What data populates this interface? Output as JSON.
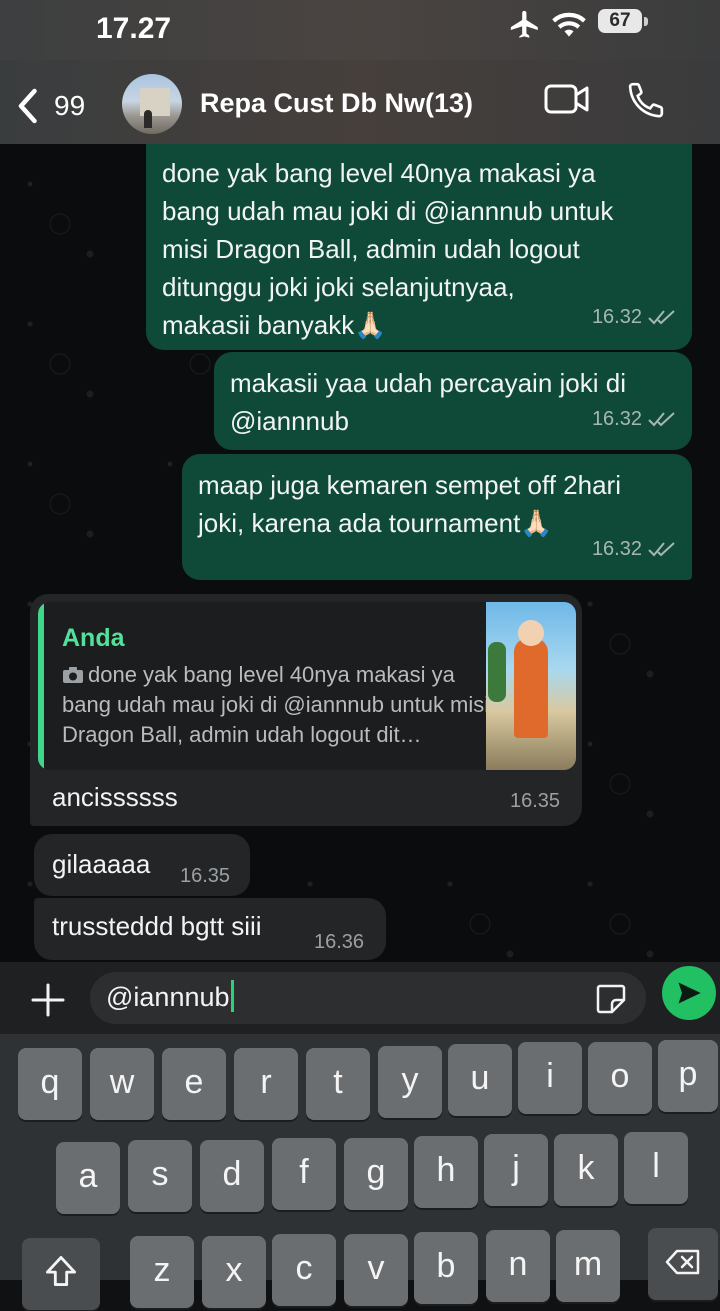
{
  "status_bar": {
    "time": "17.27",
    "battery": "67"
  },
  "header": {
    "back_count": "99",
    "title": "Repa Cust Db Nw(13)"
  },
  "messages_out": [
    {
      "text": "done yak bang level 40nya makasi ya\nbang udah mau joki di @iannnub untuk\nmisi Dragon Ball, admin udah logout\nditunggu joki joki selanjutnyaa,\nmakasii banyakk🙏🏻",
      "time": "16.32"
    },
    {
      "text": "makasii yaa udah percayain joki di\n@iannnub",
      "time": "16.32"
    },
    {
      "text": "maap juga kemaren sempet off 2hari\njoki, karena ada tournament🙏🏻",
      "time": "16.32"
    }
  ],
  "reply": {
    "quote_author": "Anda",
    "quote_text": "done yak bang level 40nya makasi ya bang udah mau joki di @iannnub untuk misi Dragon Ball, admin udah logout dit…",
    "text": "ancissssss",
    "time": "16.35"
  },
  "messages_in": [
    {
      "text": "gilaaaaa",
      "time": "16.35"
    },
    {
      "text": "trussteddd bgtt siii",
      "time": "16.36"
    }
  ],
  "composer": {
    "value": "@iannnub"
  },
  "keyboard": {
    "row1": [
      "q",
      "w",
      "e",
      "r",
      "t",
      "y",
      "u",
      "i",
      "o",
      "p"
    ],
    "row2": [
      "a",
      "s",
      "d",
      "f",
      "g",
      "h",
      "j",
      "k",
      "l"
    ],
    "row3": [
      "z",
      "x",
      "c",
      "v",
      "b",
      "n",
      "m"
    ]
  },
  "icons": {
    "back": "chevron-left-icon",
    "video": "video-camera-icon",
    "call": "phone-icon",
    "attach": "plus-icon",
    "sticker": "sticker-icon",
    "send": "send-icon",
    "read": "double-check-icon",
    "photo": "camera-icon",
    "airplane": "airplane-icon",
    "wifi": "wifi-icon",
    "shift": "shift-icon",
    "backspace": "backspace-icon"
  },
  "colors": {
    "outgoing_bubble": "#0f4a38",
    "incoming_bubble": "#232526",
    "accent": "#21c063"
  }
}
